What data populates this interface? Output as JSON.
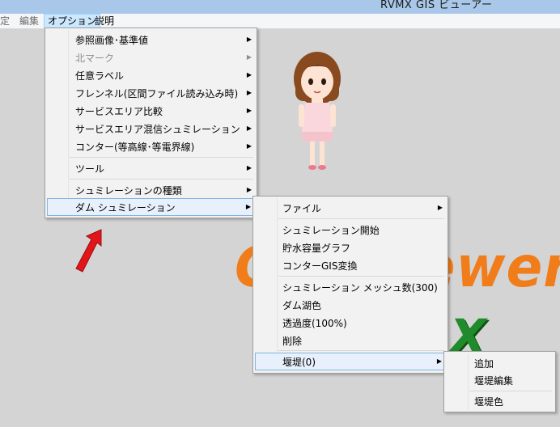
{
  "window": {
    "title": "RVMX GIS ビューアー"
  },
  "menubar": [
    {
      "label": "定",
      "state": "dim"
    },
    {
      "label": "編集",
      "state": "dim"
    },
    {
      "label": "オプション",
      "state": "active"
    },
    {
      "label": "説明",
      "state": "normal"
    }
  ],
  "options_menu": [
    {
      "label": "参照画像･基準値",
      "submenu": true
    },
    {
      "label": "北マーク",
      "submenu": true,
      "disabled": true
    },
    {
      "label": "任意ラベル",
      "submenu": true
    },
    {
      "label": "フレンネル(区間ファイル読み込み時)",
      "submenu": true
    },
    {
      "label": "サービスエリア比較",
      "submenu": true
    },
    {
      "label": "サービスエリア混信シュミレーション",
      "submenu": true
    },
    {
      "label": "コンター(等高線･等電界線)",
      "submenu": true
    },
    {
      "label": "ツール",
      "submenu": true
    },
    {
      "label": "シュミレーションの種類",
      "submenu": true
    },
    {
      "label": "ダム シュミレーション",
      "submenu": true,
      "highlighted": true
    }
  ],
  "dam_menu": [
    {
      "label": "ファイル",
      "submenu": true
    },
    {
      "label": "シュミレーション開始"
    },
    {
      "label": "貯水容量グラフ"
    },
    {
      "label": "コンターGIS変換"
    },
    {
      "label": "シュミレーション メッシュ数(300)"
    },
    {
      "label": "ダム湖色"
    },
    {
      "label": "透過度(100%)"
    },
    {
      "label": "削除"
    },
    {
      "label": "堰堤(0)",
      "submenu": true,
      "highlighted": true
    }
  ],
  "levee_menu": [
    {
      "label": "追加"
    },
    {
      "label": "堰堤編集"
    },
    {
      "label": "堰堤色"
    }
  ],
  "background": {
    "watermark_text": "GIS Viewer",
    "logo_letter": "X",
    "colors": {
      "watermark": "#f07d1a",
      "logo": "#1f8b2a",
      "arrow": "#e0161b",
      "accent": "#cce8ff"
    }
  },
  "icons": {
    "submenu_arrow": "▶",
    "annotation": "red-arrow-icon",
    "mascot": "mascot-girl-icon"
  }
}
